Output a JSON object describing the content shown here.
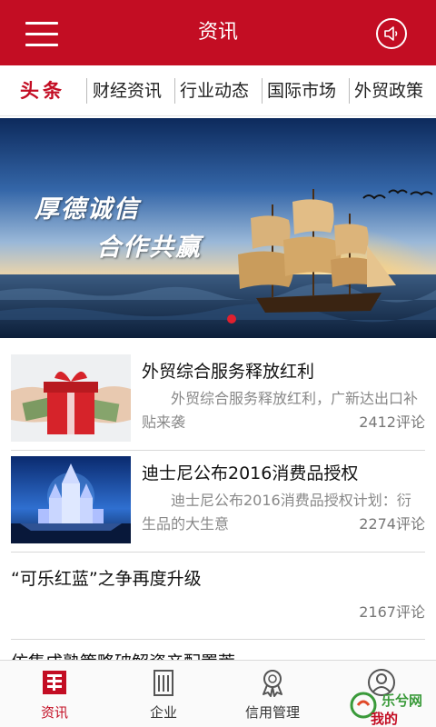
{
  "header": {
    "title": "资讯"
  },
  "tabs": [
    {
      "label": "头条",
      "active": true
    },
    {
      "label": "财经资讯"
    },
    {
      "label": "行业动态"
    },
    {
      "label": "国际市场"
    },
    {
      "label": "外贸政策"
    }
  ],
  "banner": {
    "slogan_line1": "厚德诚信",
    "slogan_line2": "合作共赢",
    "active_slide": 1,
    "slide_count": 3
  },
  "news": [
    {
      "title": "外贸综合服务释放红利",
      "summary": "外贸综合服务释放红利，广新达出口补贴来袭",
      "comments": "2412评论",
      "thumb_icon": "gift-box-money-icon"
    },
    {
      "title": "迪士尼公布2016消费品授权",
      "summary": "迪士尼公布2016消费品授权计划：衍生品的大生意",
      "comments": "2274评论",
      "thumb_icon": "castle-icon"
    },
    {
      "title": "“可乐红蓝”之争再度升级",
      "comments": "2167评论"
    },
    {
      "title": "仿集成熟策略破解资产配置荒"
    }
  ],
  "bottom_nav": [
    {
      "label": "资讯",
      "icon": "news-icon",
      "active": true
    },
    {
      "label": "企业",
      "icon": "building-icon"
    },
    {
      "label": "信用管理",
      "icon": "award-icon"
    },
    {
      "label": "我的",
      "icon": "user-icon"
    }
  ],
  "watermark": {
    "text": "乐兮网",
    "sub": "我的"
  },
  "colors": {
    "brand": "#c30d23",
    "muted": "#888888"
  }
}
